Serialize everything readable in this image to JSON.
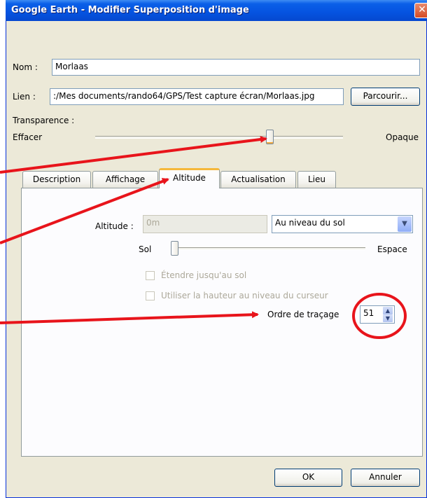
{
  "window": {
    "title": "Google Earth - Modifier Superposition d'image",
    "close_glyph": "✕"
  },
  "name": {
    "label": "Nom :",
    "value": "Morlaas"
  },
  "link": {
    "label": "Lien :",
    "value": ":/Mes documents/rando64/GPS/Test capture écran/Morlaas.jpg",
    "browse_label": "Parcourir..."
  },
  "transparency": {
    "label": "Transparence :",
    "min_label": "Effacer",
    "max_label": "Opaque",
    "level": 0.71
  },
  "tabs": [
    {
      "label": "Description"
    },
    {
      "label": "Affichage"
    },
    {
      "label": "Altitude",
      "active": true
    },
    {
      "label": "Actualisation"
    },
    {
      "label": "Lieu"
    }
  ],
  "altitude": {
    "label": "Altitude :",
    "placeholder": "0m",
    "mode_selected": "Au niveau du sol",
    "slider_min_label": "Sol",
    "slider_max_label": "Espace",
    "slider_level": 0.0,
    "extend_label": "Étendre jusqu'au sol",
    "cursor_height_label": "Utiliser la hauteur au niveau du curseur",
    "draw_order_label": "Ordre de traçage",
    "draw_order_value": "51"
  },
  "buttons": {
    "ok": "OK",
    "cancel": "Annuler"
  },
  "colors": {
    "annotation": "#E8141B",
    "title_bar": "#0553E0",
    "dialog_bg": "#ECE9D8",
    "active_tab_accent": "#F5B83B"
  }
}
